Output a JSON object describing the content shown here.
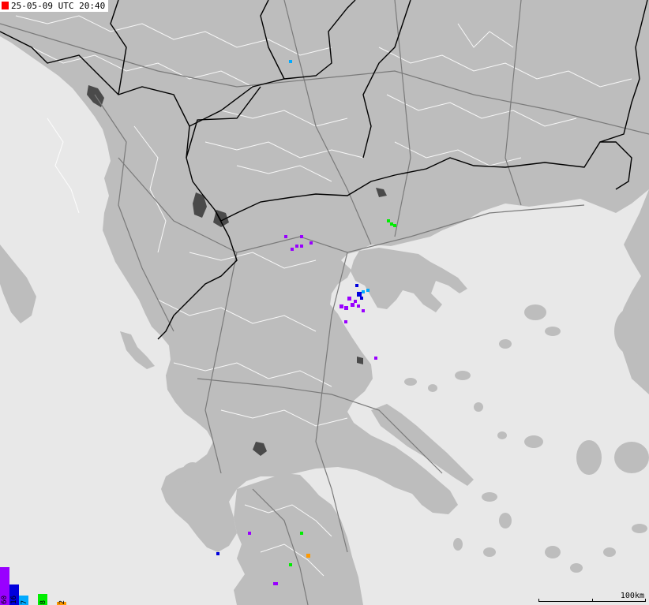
{
  "header": {
    "timestamp": "25-05-09 UTC 20:40",
    "live_indicator_color": "#ff0000"
  },
  "scale": {
    "label": "100km"
  },
  "legend": {
    "items": [
      {
        "label": "60",
        "color": "#9900ff"
      },
      {
        "label": "16",
        "color": "#0000dd"
      },
      {
        "label": "7",
        "color": "#00aaff"
      },
      {
        "label": "8",
        "color": "#00ee00"
      },
      {
        "label": "2",
        "color": "#ff9900"
      }
    ]
  },
  "colors": {
    "sea": "#e8e8e8",
    "land": "#bdbdbd",
    "lakes": "#4a4a4a",
    "borders": "#000000",
    "regions": "#ffffff",
    "roads": "#808080"
  },
  "strikes": {
    "age_class_colors": {
      "recent": "#0000dd",
      "mid": "#00aaff",
      "old": "#9900ff",
      "green": "#00ee00",
      "orange": "#ff9900"
    }
  }
}
